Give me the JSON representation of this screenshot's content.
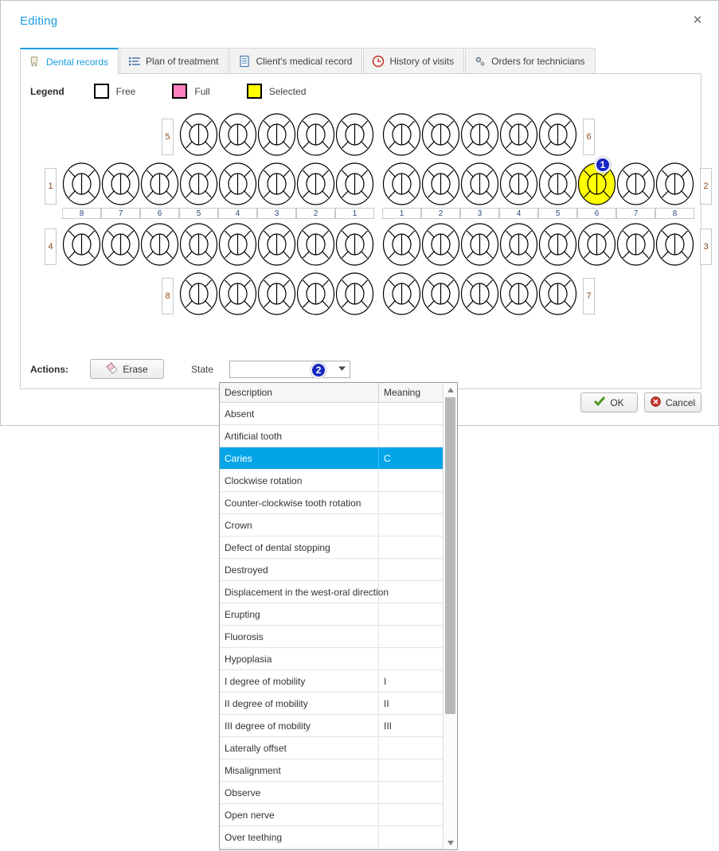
{
  "window": {
    "title": "Editing",
    "close_icon": "close-icon",
    "close_label": "✕"
  },
  "tabs": [
    {
      "label": "Dental records",
      "icon": "tooth-icon",
      "active": true
    },
    {
      "label": "Plan of treatment",
      "icon": "list-icon",
      "active": false
    },
    {
      "label": "Client's medical record",
      "icon": "document-icon",
      "active": false
    },
    {
      "label": "History of visits",
      "icon": "clock-icon",
      "active": false
    },
    {
      "label": "Orders for technicians",
      "icon": "gears-icon",
      "active": false
    }
  ],
  "legend": {
    "label": "Legend",
    "items": [
      {
        "text": "Free",
        "color": "#ffffff"
      },
      {
        "text": "Full",
        "color": "#ff80bf"
      },
      {
        "text": "Selected",
        "color": "#ffff00"
      }
    ]
  },
  "chart": {
    "rows": [
      {
        "left_quadrant": "5",
        "right_quadrant": "6",
        "left_count": 5,
        "right_count": 5
      },
      {
        "left_quadrant": "1",
        "right_quadrant": "2",
        "left_count": 8,
        "right_count": 8
      },
      {
        "left_quadrant": "4",
        "right_quadrant": "3",
        "left_count": 8,
        "right_count": 8
      },
      {
        "left_quadrant": "8",
        "right_quadrant": "7",
        "left_count": 5,
        "right_count": 5
      }
    ],
    "numbers_left": [
      "8",
      "7",
      "6",
      "5",
      "4",
      "3",
      "2",
      "1"
    ],
    "numbers_right": [
      "1",
      "2",
      "3",
      "4",
      "5",
      "6",
      "7",
      "8"
    ],
    "selected_tooth": {
      "quadrant": "2",
      "number": "6",
      "color": "#ffff00"
    },
    "badge_1": "1"
  },
  "actions": {
    "label": "Actions:",
    "erase_label": "Erase",
    "erase_icon": "eraser-icon",
    "state_label": "State",
    "state_value": "",
    "state_placeholder": "",
    "dropdown_arrow_icon": "chevron-down-icon",
    "badge_2": "2"
  },
  "footer": {
    "ok_label": "OK",
    "ok_icon": "check-icon",
    "cancel_label": "Cancel",
    "cancel_icon": "error-icon"
  },
  "dropdown": {
    "columns": [
      "Description",
      "Meaning"
    ],
    "scroll_up_icon": "triangle-up-icon",
    "scroll_down_icon": "triangle-down-icon",
    "rows": [
      {
        "description": "Absent",
        "meaning": "",
        "selected": false
      },
      {
        "description": "Artificial tooth",
        "meaning": "",
        "selected": false
      },
      {
        "description": "Caries",
        "meaning": "C",
        "selected": true
      },
      {
        "description": "Clockwise rotation",
        "meaning": "",
        "selected": false
      },
      {
        "description": "Counter-clockwise tooth rotation",
        "meaning": "",
        "selected": false
      },
      {
        "description": "Crown",
        "meaning": "",
        "selected": false
      },
      {
        "description": "Defect of dental stopping",
        "meaning": "",
        "selected": false
      },
      {
        "description": "Destroyed",
        "meaning": "",
        "selected": false
      },
      {
        "description": "Displacement in the west-oral direction",
        "meaning": "",
        "selected": false
      },
      {
        "description": "Erupting",
        "meaning": "",
        "selected": false
      },
      {
        "description": "Fluorosis",
        "meaning": "",
        "selected": false
      },
      {
        "description": "Hypoplasia",
        "meaning": "",
        "selected": false
      },
      {
        "description": "I degree of mobility",
        "meaning": "I",
        "selected": false
      },
      {
        "description": "II degree of mobility",
        "meaning": "II",
        "selected": false
      },
      {
        "description": "III degree of mobility",
        "meaning": "III",
        "selected": false
      },
      {
        "description": "Laterally offset",
        "meaning": "",
        "selected": false
      },
      {
        "description": "Misalignment",
        "meaning": "",
        "selected": false
      },
      {
        "description": "Observe",
        "meaning": "",
        "selected": false
      },
      {
        "description": "Open nerve",
        "meaning": "",
        "selected": false
      },
      {
        "description": "Over teething",
        "meaning": "",
        "selected": false
      }
    ]
  }
}
